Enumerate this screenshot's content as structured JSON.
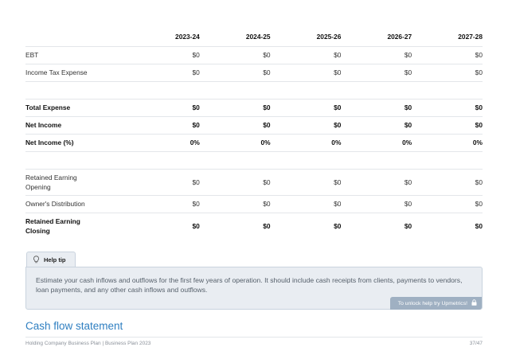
{
  "table": {
    "headers": [
      "",
      "2023-24",
      "2024-25",
      "2025-26",
      "2026-27",
      "2027-28"
    ],
    "rows": {
      "ebt": {
        "label": "EBT",
        "values": [
          "$0",
          "$0",
          "$0",
          "$0",
          "$0"
        ]
      },
      "income_tax": {
        "label": "Income Tax Expense",
        "values": [
          "$0",
          "$0",
          "$0",
          "$0",
          "$0"
        ]
      },
      "total_expense": {
        "label": "Total Expense",
        "values": [
          "$0",
          "$0",
          "$0",
          "$0",
          "$0"
        ]
      },
      "net_income": {
        "label": "Net Income",
        "values": [
          "$0",
          "$0",
          "$0",
          "$0",
          "$0"
        ]
      },
      "net_income_pct": {
        "label": "Net Income (%)",
        "values": [
          "0%",
          "0%",
          "0%",
          "0%",
          "0%"
        ]
      },
      "retained_opening": {
        "label": "Retained Earning Opening",
        "values": [
          "$0",
          "$0",
          "$0",
          "$0",
          "$0"
        ]
      },
      "owners_distribution": {
        "label": "Owner's Distribution",
        "values": [
          "$0",
          "$0",
          "$0",
          "$0",
          "$0"
        ]
      },
      "retained_closing": {
        "label": "Retained Earning Closing",
        "values": [
          "$0",
          "$0",
          "$0",
          "$0",
          "$0"
        ]
      }
    }
  },
  "help_tip": {
    "tab_label": "Help tip",
    "text": "Estimate your cash inflows and outflows for the first few years of operation. It should include cash receipts from clients, payments to vendors, loan payments, and any other cash inflows and outflows.",
    "unlock_label": "To unlock help try Upmetrics!"
  },
  "section_title": "Cash flow statement",
  "footer": {
    "left": "Holding Company Business Plan | Business Plan 2023",
    "right": "37/47"
  },
  "icons": {
    "tip": "lightbulb-icon",
    "unlock": "lock-icon"
  },
  "colors": {
    "accent": "#2f7fc1",
    "tip_background": "#e9edf2",
    "unlock_background": "#9fb0c2"
  }
}
